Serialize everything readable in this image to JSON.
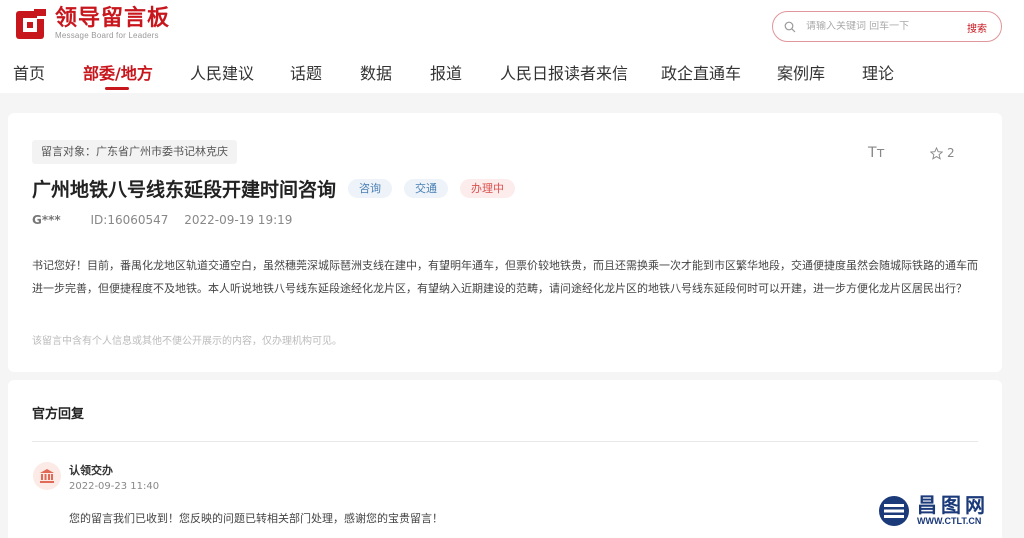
{
  "header": {
    "logo_title": "领导留言板",
    "logo_subtitle": "Message Board for Leaders",
    "search": {
      "placeholder": "请输入关键词 回车一下",
      "button_label": "搜索"
    }
  },
  "nav": {
    "items": [
      {
        "label": "首页"
      },
      {
        "label": "部委/地方",
        "active": true
      },
      {
        "label": "人民建议"
      },
      {
        "label": "话题"
      },
      {
        "label": "数据"
      },
      {
        "label": "报道"
      },
      {
        "label": "人民日报读者来信"
      },
      {
        "label": "政企直通车"
      },
      {
        "label": "案例库"
      },
      {
        "label": "理论"
      }
    ]
  },
  "message": {
    "target": "留言对象：广东省广州市委书记林克庆",
    "font_size_label": "Tт",
    "favorite_count": "2",
    "title": "广州地铁八号线东延段开建时间咨询",
    "tags": [
      {
        "label": "咨询",
        "color": "#4a7fb3"
      },
      {
        "label": "交通",
        "color": "#4a7fb3"
      },
      {
        "label": "办理中",
        "color": "#d9534f"
      }
    ],
    "author": "G***",
    "id": "ID:16060547",
    "datetime": "2022-09-19 19:19",
    "body": "书记您好！目前，番禺化龙地区轨道交通空白，虽然穗莞深城际琶洲支线在建中，有望明年通车，但票价较地铁贵，而且还需换乘一次才能到市区繁华地段，交通便捷度虽然会随城际铁路的通车而进一步完善，但便捷程度不及地铁。本人听说地铁八号线东延段途经化龙片区，有望纳入近期建设的范畴，请问途经化龙片区的地铁八号线东延段何时可以开建，进一步方便化龙片区居民出行？",
    "notice": "该留言中含有个人信息或其他不便公开展示的内容，仅办理机构可见。"
  },
  "reply": {
    "section_title": "官方回复",
    "replier": "认领交办",
    "datetime": "2022-09-23 11:40",
    "text": "您的留言我们已收到！您反映的问题已转相关部门处理，感谢您的宝贵留言！"
  },
  "watermark": {
    "name": "昌图网",
    "url": "WWW.CTLT.CN"
  },
  "colors": {
    "brand_red": "#c8161d",
    "watermark_blue": "#1b3a7a"
  }
}
